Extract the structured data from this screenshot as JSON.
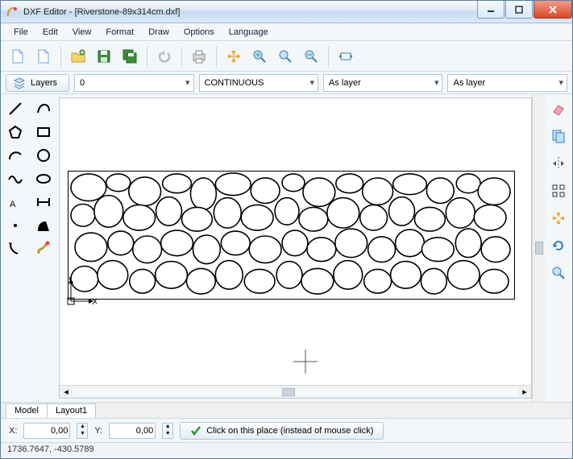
{
  "title": "DXF Editor - [Riverstone-89x314cm.dxf]",
  "menu": [
    "File",
    "Edit",
    "View",
    "Format",
    "Draw",
    "Options",
    "Language"
  ],
  "layers_button": "Layers",
  "dropdowns": {
    "layer": "0",
    "linetype": "CONTINUOUS",
    "color": "As layer",
    "lineweight": "As layer"
  },
  "tabs": {
    "model": "Model",
    "layout": "Layout1"
  },
  "coords": {
    "x_label": "X:",
    "x_value": "0,00",
    "y_label": "Y:",
    "y_value": "0,00"
  },
  "click_button": "Click on this place (instead of mouse click)",
  "status": "1736.7647, -430.5789",
  "axis": {
    "x": "X",
    "y": "Y"
  }
}
